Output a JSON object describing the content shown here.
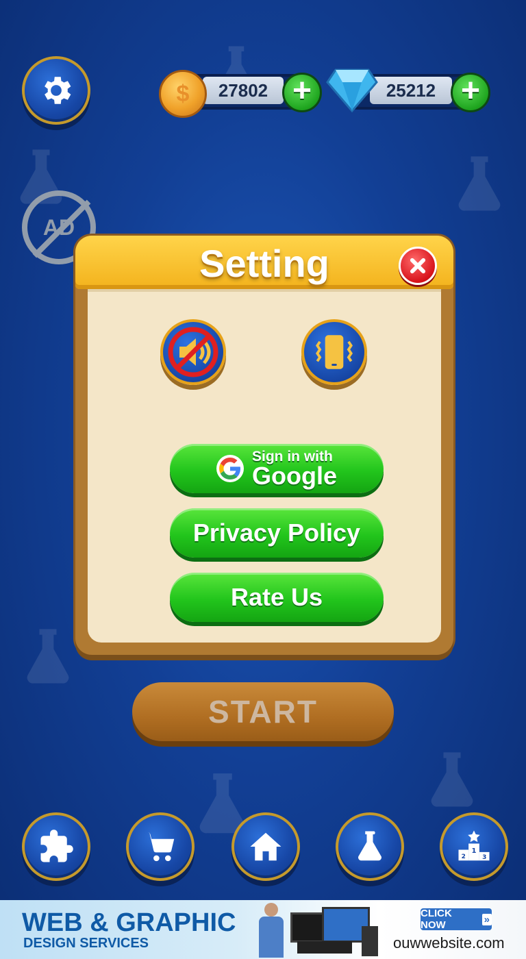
{
  "modal": {
    "title": "Setting",
    "sound_toggle_icon": "muted-speaker-icon",
    "vibrate_toggle_icon": "vibrate-phone-icon",
    "google_line1": "Sign in with",
    "google_line2": "Google",
    "privacy_label": "Privacy Policy",
    "rate_label": "Rate Us"
  },
  "hud": {
    "coins": "27802",
    "gems": "25212",
    "ad_badge": "AD"
  },
  "start_label": "START",
  "bottom_nav": [
    {
      "icon": "puzzle-icon"
    },
    {
      "icon": "cart-icon"
    },
    {
      "icon": "home-icon"
    },
    {
      "icon": "flask-icon"
    },
    {
      "icon": "podium-icon"
    }
  ],
  "banner": {
    "title": "WEB & GRAPHIC",
    "subtitle": "DESIGN SERVICES",
    "cta": "CLICK NOW",
    "url": "ouwwebsite.com"
  },
  "colors": {
    "background": "#123f95",
    "panel": "#f4e6c8",
    "header": "#f3b21c",
    "green": "#22c51c",
    "start": "#b06e22"
  }
}
